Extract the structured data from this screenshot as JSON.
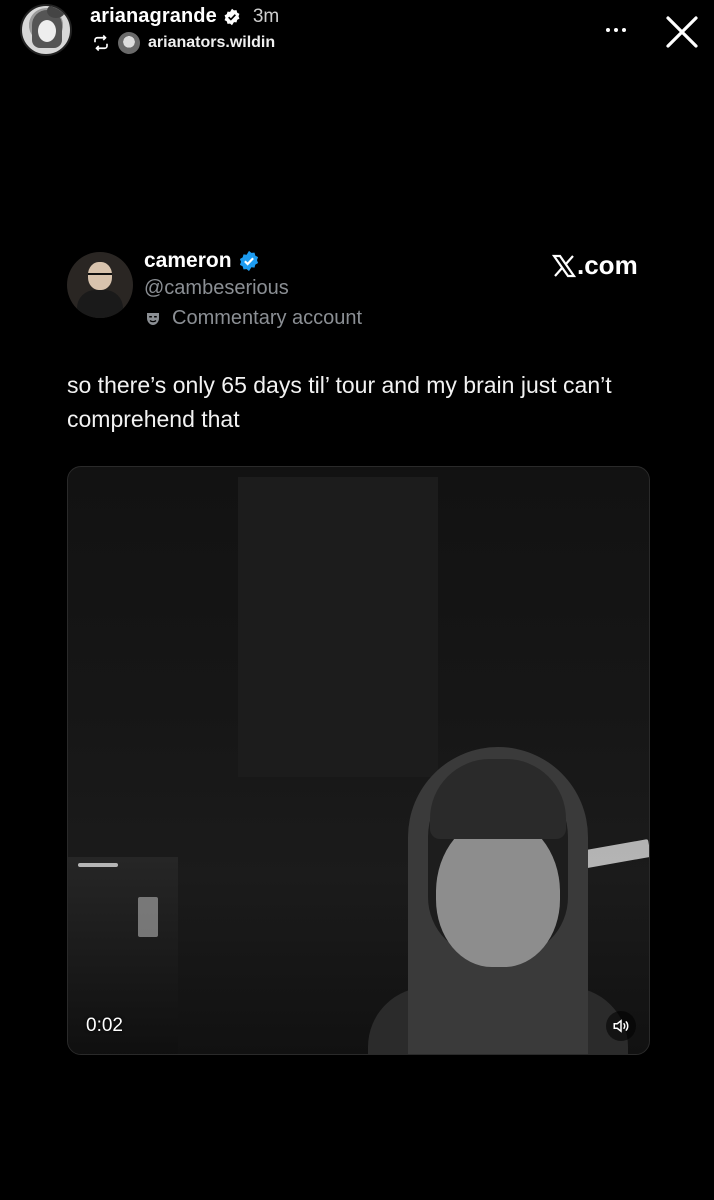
{
  "story": {
    "username": "arianagrande",
    "time_ago": "3m",
    "repost_from": "arianators.wildin",
    "icons": [
      "verified-badge-icon",
      "repost-icon",
      "more-options-icon",
      "close-icon"
    ]
  },
  "tweet": {
    "display_name": "cameron",
    "handle": "@cambeserious",
    "badge_label": "Commentary account",
    "source": ".com",
    "text": "so there’s only 65 days til’ tour and my brain just can’t comprehend that",
    "colors": {
      "verified": "#1d9bf0",
      "secondary_text": "#8b8f94"
    }
  },
  "video": {
    "elapsed": "0:02",
    "icons": [
      "volume-icon"
    ]
  }
}
